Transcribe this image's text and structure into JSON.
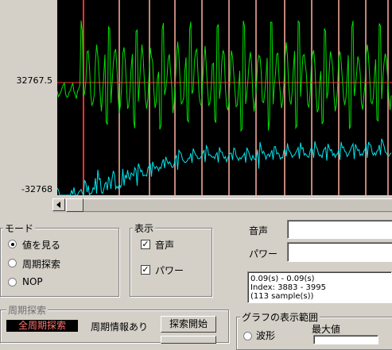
{
  "graph": {
    "y_max_label": "32767.5",
    "y_min_label": "-32768",
    "colors": {
      "voice": "#00e000",
      "power": "#00e5ee",
      "marker": "#ff3030",
      "period": "#ffb0a0",
      "zero": "#ff3030"
    }
  },
  "mode": {
    "legend": "モード",
    "options": [
      "値を見る",
      "周期探索",
      "NOP"
    ],
    "selected": "値を見る"
  },
  "display": {
    "legend": "表示",
    "voice_label": "音声",
    "power_label": "パワー",
    "voice_checked": true,
    "power_checked": true
  },
  "readout": {
    "voice_label": "音声",
    "power_label": "パワー",
    "voice_value": "",
    "power_value": ""
  },
  "info": {
    "line1": "0.09(s) - 0.09(s)",
    "line2": "Index: 3883 - 3995",
    "line3": "(113 sample(s))"
  },
  "period_search": {
    "legend": "周期探索",
    "badge": "全周期探索",
    "status": "周期情報あり",
    "start_button": "探索開始"
  },
  "graph_range": {
    "legend": "グラフの表示範囲",
    "waveform_label": "波形",
    "max_label": "最大値"
  }
}
